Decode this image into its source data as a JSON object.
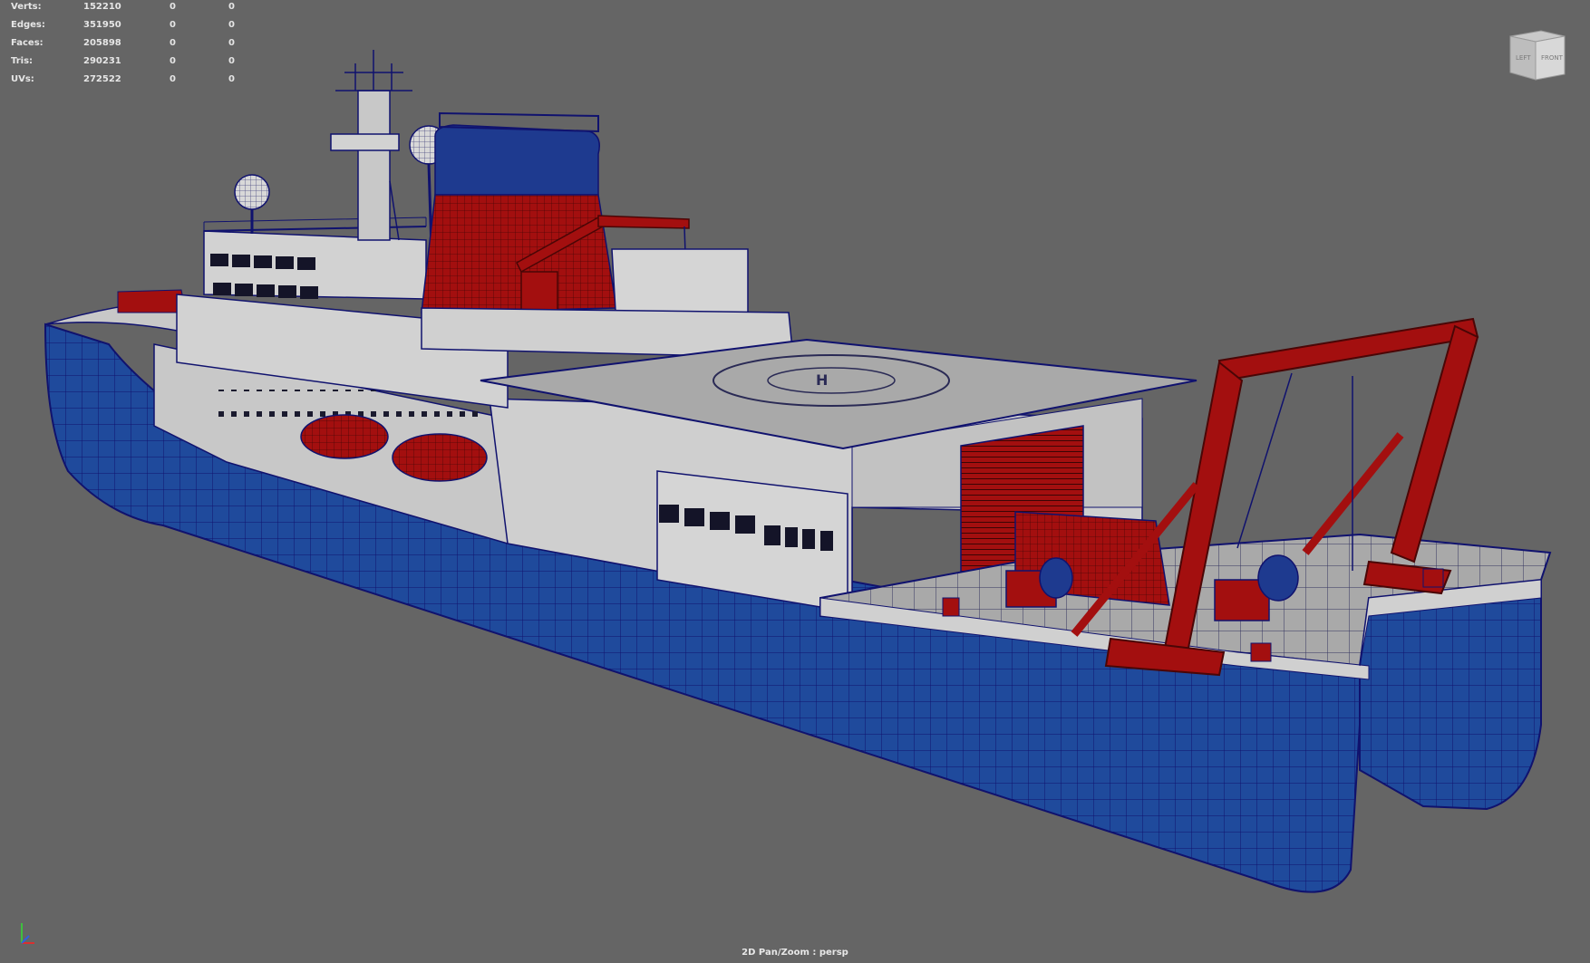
{
  "hud": {
    "rows": [
      {
        "label": "Verts:",
        "v1": "152210",
        "v2": "0",
        "v3": "0"
      },
      {
        "label": "Edges:",
        "v1": "351950",
        "v2": "0",
        "v3": "0"
      },
      {
        "label": "Faces:",
        "v1": "205898",
        "v2": "0",
        "v3": "0"
      },
      {
        "label": "Tris:",
        "v1": "290231",
        "v2": "0",
        "v3": "0"
      },
      {
        "label": "UVs:",
        "v1": "272522",
        "v2": "0",
        "v3": "0"
      }
    ]
  },
  "view_cube": {
    "left_face": "LEFT",
    "front_face": "FRONT"
  },
  "status": {
    "camera": "2D Pan/Zoom : persp"
  },
  "scene": {
    "subject": "research-ship-model",
    "colors": {
      "background": "#656565",
      "hull": "#1f4a9c",
      "wireframe": "#10126e",
      "superstructure": "#c8c8c8",
      "deck": "#a8a8a8",
      "accent_red": "#a30f0f",
      "funnel_top": "#1e3a8f"
    }
  },
  "axis_gizmo": {
    "icon": "axis-gizmo-icon"
  }
}
